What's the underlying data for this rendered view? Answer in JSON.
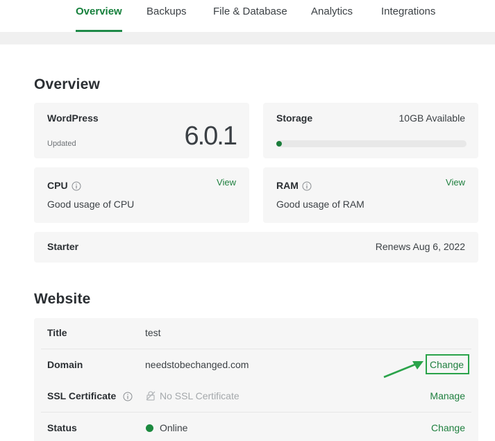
{
  "tabs": [
    {
      "label": "Overview",
      "active": true
    },
    {
      "label": "Backups",
      "active": false
    },
    {
      "label": "File & Database",
      "active": false
    },
    {
      "label": "Analytics",
      "active": false
    },
    {
      "label": "Integrations",
      "active": false
    }
  ],
  "overview": {
    "heading": "Overview",
    "wordpress": {
      "label": "WordPress",
      "status": "Updated",
      "version": "6.0.1"
    },
    "storage": {
      "label": "Storage",
      "available": "10GB Available",
      "used_fraction": 0.02
    },
    "cpu": {
      "label": "CPU",
      "description": "Good usage of CPU",
      "link": "View"
    },
    "ram": {
      "label": "RAM",
      "description": "Good usage of RAM",
      "link": "View"
    },
    "plan": {
      "label": "Starter",
      "renewal": "Renews Aug 6, 2022"
    }
  },
  "website": {
    "heading": "Website",
    "rows": [
      {
        "label": "Title",
        "value": "test"
      },
      {
        "label": "Domain",
        "value": "needstobechanged.com",
        "action": "Change"
      },
      {
        "label": "SSL Certificate",
        "value": "No SSL Certificate",
        "action": "Manage"
      },
      {
        "label": "Status",
        "value": "Online",
        "action": "Change"
      }
    ]
  },
  "colors": {
    "accent": "#1e7f3e",
    "highlight": "#2aa34a",
    "card": "#f6f6f6"
  },
  "icons": [
    "info-icon",
    "ssl-lock-off-icon",
    "status-online-dot",
    "annotation-arrow"
  ]
}
